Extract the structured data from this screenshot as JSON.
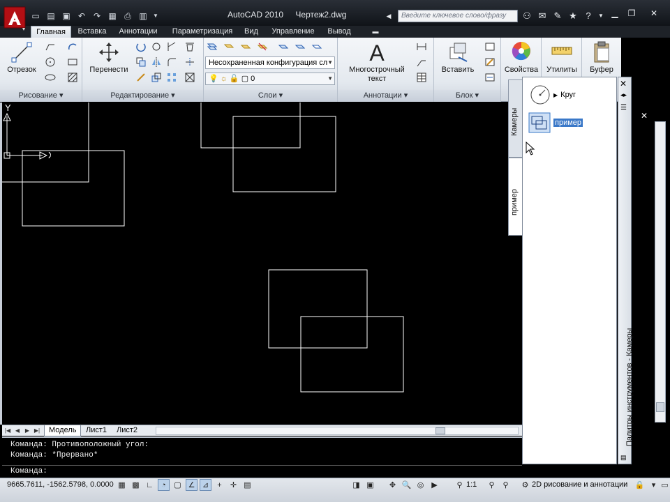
{
  "app": {
    "name": "AutoCAD 2010",
    "file": "Чертеж2.dwg"
  },
  "search": {
    "placeholder": "Введите ключевое слово/фразу"
  },
  "ribbon_tabs": [
    "Главная",
    "Вставка",
    "Аннотации",
    "Параметризация",
    "Вид",
    "Управление",
    "Вывод"
  ],
  "panels": {
    "draw": {
      "title": "Рисование",
      "line_label": "Отрезок"
    },
    "modify": {
      "title": "Редактирование",
      "move_label": "Перенести"
    },
    "layers": {
      "title": "Слои",
      "state_value": "Несохраненная конфигурация сл",
      "layer_value": "0"
    },
    "annotation": {
      "title": "Аннотации",
      "mtext_label_1": "Многострочный",
      "mtext_label_2": "текст"
    },
    "block": {
      "title": "Блок",
      "insert_label": "Вставить"
    },
    "properties": {
      "label": "Свойства"
    },
    "utilities": {
      "label": "Утилиты"
    },
    "clipboard": {
      "label": "Буфер"
    }
  },
  "layout_tabs": [
    "Модель",
    "Лист1",
    "Лист2"
  ],
  "ucs": {
    "x": "X",
    "y": "Y"
  },
  "command_history": [
    "Команда: Противоположный угол:",
    "Команда: *Прервано*"
  ],
  "command_prompt": "Команда:",
  "status": {
    "coords": "9665.7611, -1562.5798, 0.0000",
    "scale": "1:1",
    "workspace": "2D рисование и аннотации"
  },
  "palette": {
    "title": "Палитры инструментов - Камеры",
    "tabs": [
      "Камеры",
      "пример"
    ],
    "items": [
      {
        "label": "Круг",
        "icon": "circle-tool-icon"
      },
      {
        "label": "пример",
        "icon": "rectangles-block-icon"
      }
    ]
  },
  "colors": {
    "drawing_bg": "#000000",
    "geometry": "#ffffff",
    "selection": "#3a78c8",
    "ribbon_light": "#f4f6f9",
    "ribbon_dark": "#cfd6df"
  }
}
